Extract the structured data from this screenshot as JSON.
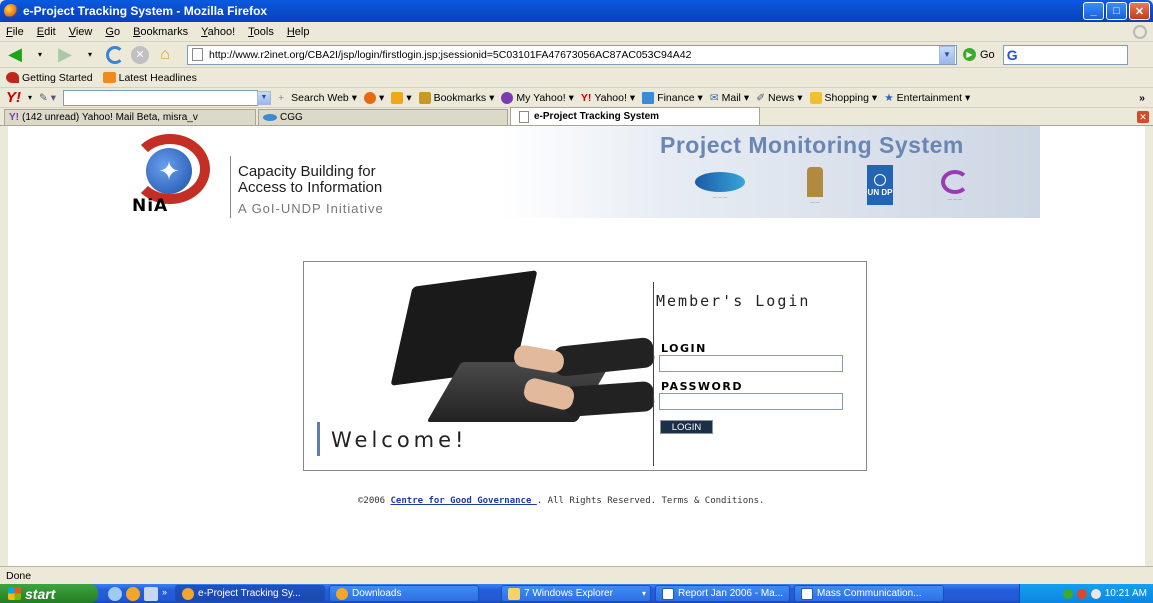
{
  "window": {
    "title": "e-Project Tracking System - Mozilla Firefox"
  },
  "menu": [
    "File",
    "Edit",
    "View",
    "Go",
    "Bookmarks",
    "Yahoo!",
    "Tools",
    "Help"
  ],
  "nav": {
    "url": "http://www.r2inet.org/CBA2I/jsp/login/firstlogin.jsp;jsessionid=5C03101FA47673056AC87AC053C94A42",
    "go_label": "Go",
    "search_value": "G"
  },
  "bookmarks": [
    "Getting Started",
    "Latest Headlines"
  ],
  "yahoo_toolbar": {
    "logo": "Y!",
    "items": [
      "Search Web",
      "Bookmarks",
      "My Yahoo!",
      "Yahoo!",
      "Finance",
      "Mail",
      "News",
      "Shopping",
      "Entertainment"
    ],
    "more": "»"
  },
  "tabs": [
    {
      "label": "(142 unread) Yahoo! Mail Beta, misra_v"
    },
    {
      "label": "CGG"
    },
    {
      "label": "e-Project Tracking System"
    }
  ],
  "banner": {
    "org_line1": "Capacity Building for",
    "org_line2": "Access to Information",
    "nia": "NiA",
    "tagline": "A GoI-UNDP Initiative",
    "title": "Project Monitoring System",
    "undp": "UN DP"
  },
  "login": {
    "heading": "Member's Login",
    "login_label": "LOGIN",
    "password_label": "PASSWORD",
    "login_value": "",
    "password_value": "",
    "button": "LOGIN",
    "welcome": "Welcome!"
  },
  "footer": {
    "prefix": "©2006 ",
    "link": "Centre for Good Governance ",
    "suffix": ". All Rights Reserved. Terms & Conditions."
  },
  "status": "Done",
  "taskbar": {
    "start": "start",
    "tasks": [
      {
        "label": "e-Project Tracking Sy...",
        "active": false
      },
      {
        "label": "Downloads",
        "active": false
      },
      {
        "label": "7 Windows Explorer",
        "active": false
      },
      {
        "label": "Report Jan 2006 - Ma...",
        "active": false
      },
      {
        "label": "Mass Communication...",
        "active": false
      }
    ],
    "clock": "10:21 AM"
  }
}
